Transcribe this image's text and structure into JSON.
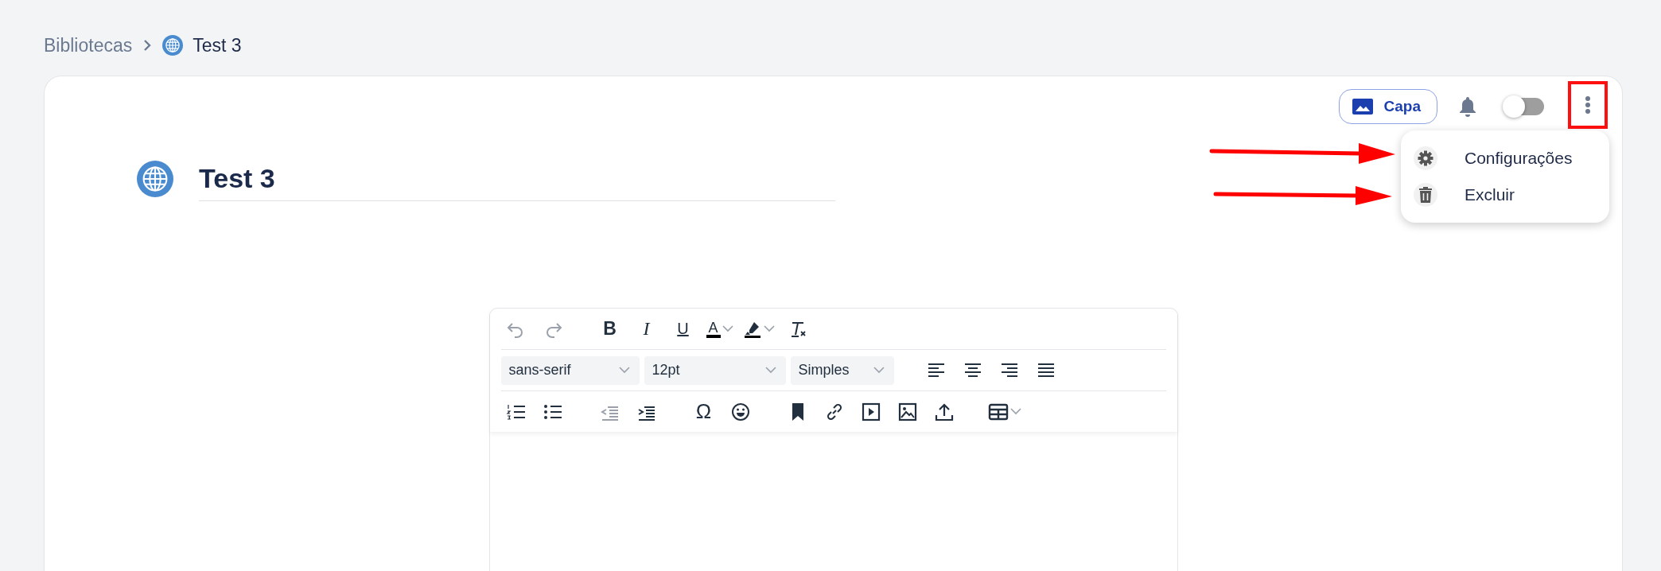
{
  "breadcrumb": [
    {
      "label": "Bibliotecas",
      "current": false
    },
    {
      "label": "Test 3",
      "current": true
    }
  ],
  "header_actions": {
    "cover_button": {
      "label": "Capa"
    },
    "notifications_toggle": {
      "on": false
    }
  },
  "overflow_menu": {
    "expanded": true,
    "items": [
      {
        "label": "Configurações",
        "kind": "settings"
      },
      {
        "label": "Excluir",
        "kind": "delete"
      }
    ]
  },
  "page": {
    "title": "Test 3"
  },
  "editor": {
    "history": [
      {
        "kind": "undo",
        "disabled": true
      },
      {
        "kind": "redo",
        "disabled": true
      }
    ],
    "format_buttons": [
      {
        "kind": "bold",
        "glyph": "B"
      },
      {
        "kind": "italic",
        "glyph": "I"
      },
      {
        "kind": "underline",
        "glyph": "U"
      },
      {
        "kind": "text_color",
        "glyph": "A"
      }
    ],
    "selects": [
      {
        "value": "sans-serif"
      },
      {
        "value": "12pt"
      },
      {
        "value": "Simples"
      }
    ],
    "indent": [
      {
        "kind": "outdent",
        "disabled": true
      },
      {
        "kind": "indent",
        "disabled": false
      }
    ],
    "special_character": {
      "glyph": "Ω"
    }
  }
}
